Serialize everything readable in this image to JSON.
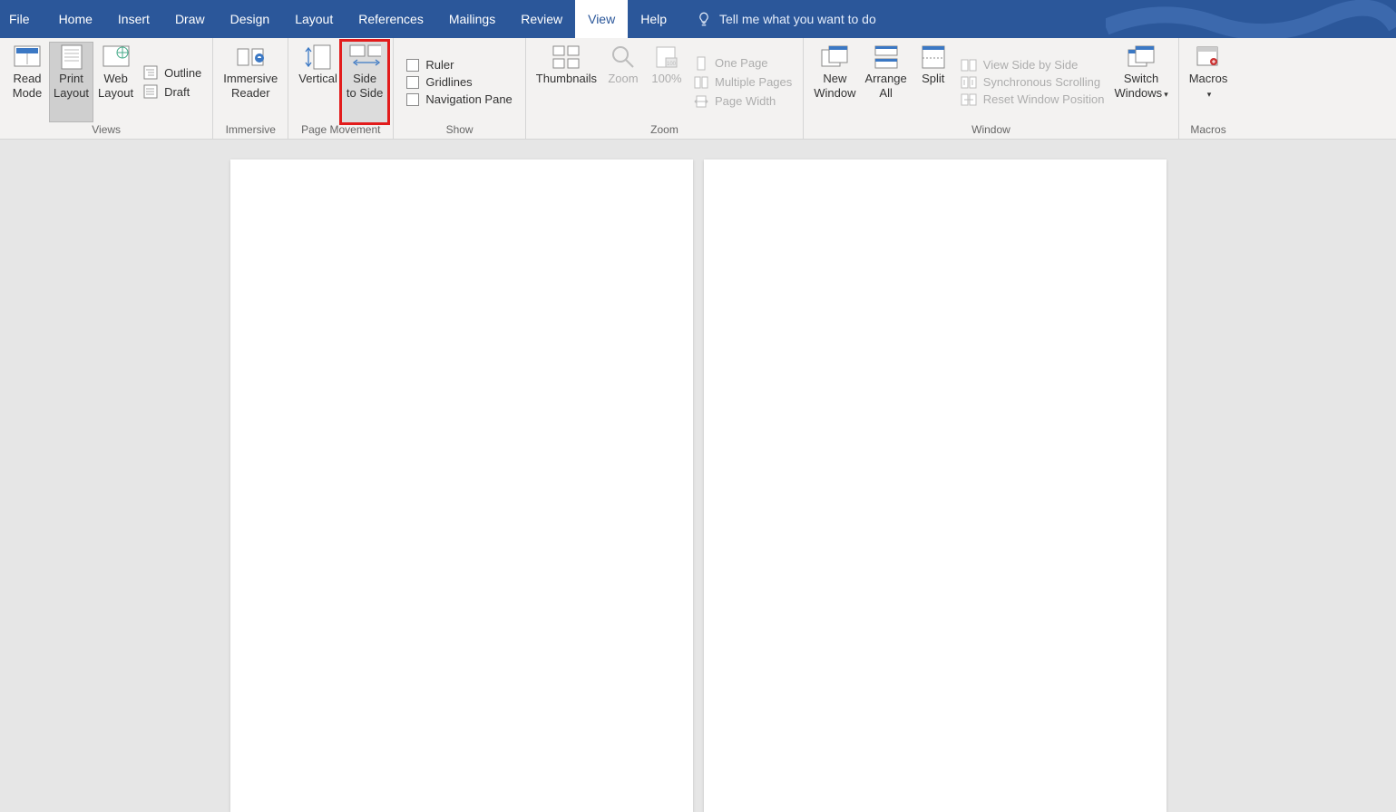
{
  "menu": {
    "tabs": [
      "File",
      "Home",
      "Insert",
      "Draw",
      "Design",
      "Layout",
      "References",
      "Mailings",
      "Review",
      "View",
      "Help"
    ],
    "active": "View",
    "tellme": "Tell me what you want to do"
  },
  "ribbon": {
    "groups": {
      "views": {
        "label": "Views",
        "read_mode": "Read\nMode",
        "print_layout": "Print\nLayout",
        "web_layout": "Web\nLayout",
        "outline": "Outline",
        "draft": "Draft"
      },
      "immersive": {
        "label": "Immersive",
        "reader": "Immersive\nReader"
      },
      "page_movement": {
        "label": "Page Movement",
        "vertical": "Vertical",
        "side_to_side": "Side\nto Side"
      },
      "show": {
        "label": "Show",
        "ruler": "Ruler",
        "gridlines": "Gridlines",
        "nav": "Navigation Pane"
      },
      "zoom": {
        "label": "Zoom",
        "thumbnails": "Thumbnails",
        "zoom": "Zoom",
        "hundred": "100%",
        "one_page": "One Page",
        "multi_pages": "Multiple Pages",
        "page_width": "Page Width"
      },
      "window": {
        "label": "Window",
        "new_window": "New\nWindow",
        "arrange_all": "Arrange\nAll",
        "split": "Split",
        "side_by_side": "View Side by Side",
        "sync": "Synchronous Scrolling",
        "reset_pos": "Reset Window Position",
        "switch": "Switch\nWindows"
      },
      "macros": {
        "label": "Macros",
        "macros": "Macros"
      }
    }
  }
}
